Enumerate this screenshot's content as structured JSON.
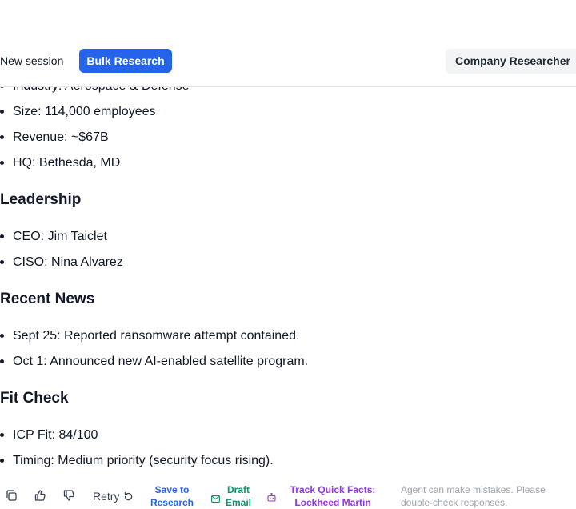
{
  "header": {
    "new_session": "New session",
    "bulk_research": "Bulk Research",
    "agent_name": "Company Researcher"
  },
  "content": {
    "overview_bullets": [
      "Industry: Aerospace & Defense",
      "Size: 114,000 employees",
      "Revenue: ~$67B",
      "HQ: Bethesda, MD"
    ],
    "leadership": {
      "heading": "Leadership",
      "bullets": [
        "CEO: Jim Taiclet",
        "CISO: Nina Alvarez"
      ]
    },
    "recent_news": {
      "heading": "Recent News",
      "bullets": [
        "Sept 25: Reported ransomware attempt contained.",
        "Oct 1: Announced new AI-enabled satellite program."
      ]
    },
    "fit_check": {
      "heading": "Fit Check",
      "bullets": [
        "ICP Fit: 84/100",
        "Timing: Medium priority (security focus rising)."
      ]
    }
  },
  "footer": {
    "retry": "Retry",
    "save_line1": "Save to",
    "save_line2": "Research",
    "draft_line1": "Draft",
    "draft_line2": "Email",
    "track_line1": "Track Quick Facts:",
    "track_line2": "Lockheed Martin",
    "disclaimer": "Agent can make mistakes. Please double-check responses.",
    "icons": [
      "copy-icon",
      "thumbs-up-icon",
      "thumbs-down-icon",
      "retry-icon",
      "mail-icon",
      "bot-icon"
    ]
  },
  "colors": {
    "accent_blue": "#2563eb",
    "action_green": "#059669",
    "action_purple": "#9333ea",
    "muted_text": "#9ca3af"
  }
}
